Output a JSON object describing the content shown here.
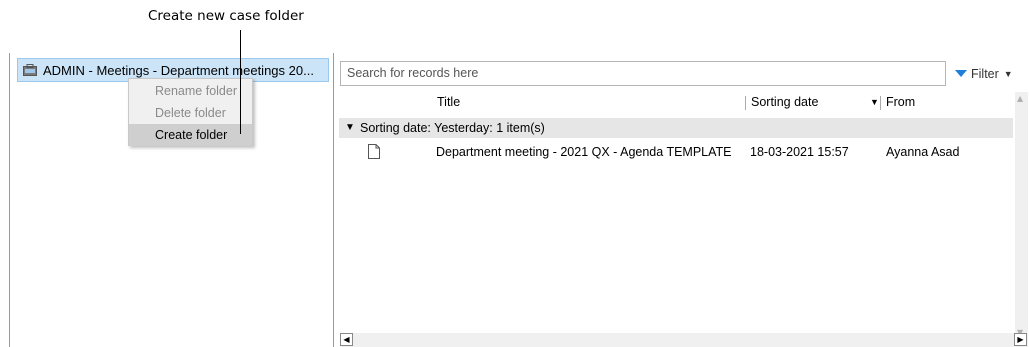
{
  "annotation": {
    "text": "Create new case folder"
  },
  "tree": {
    "selected_item": "ADMIN - Meetings - Department meetings 20..."
  },
  "context_menu": {
    "items": [
      "Rename folder",
      "Delete folder",
      "Create folder"
    ]
  },
  "search": {
    "placeholder": "Search for records here"
  },
  "filter": {
    "label": "Filter"
  },
  "grid": {
    "columns": {
      "title": "Title",
      "sorting_date": "Sorting date",
      "from": "From"
    },
    "group_label": "Sorting date: Yesterday: 1 item(s)",
    "rows": [
      {
        "title": "Department meeting - 2021 QX - Agenda TEMPLATE",
        "sorting_date": "18-03-2021 15:57",
        "from": "Ayanna Asad"
      }
    ]
  },
  "colors": {
    "selection": "#cce4f7",
    "accent": "#1e7fd8",
    "menu_bg": "#f0f0f0"
  }
}
